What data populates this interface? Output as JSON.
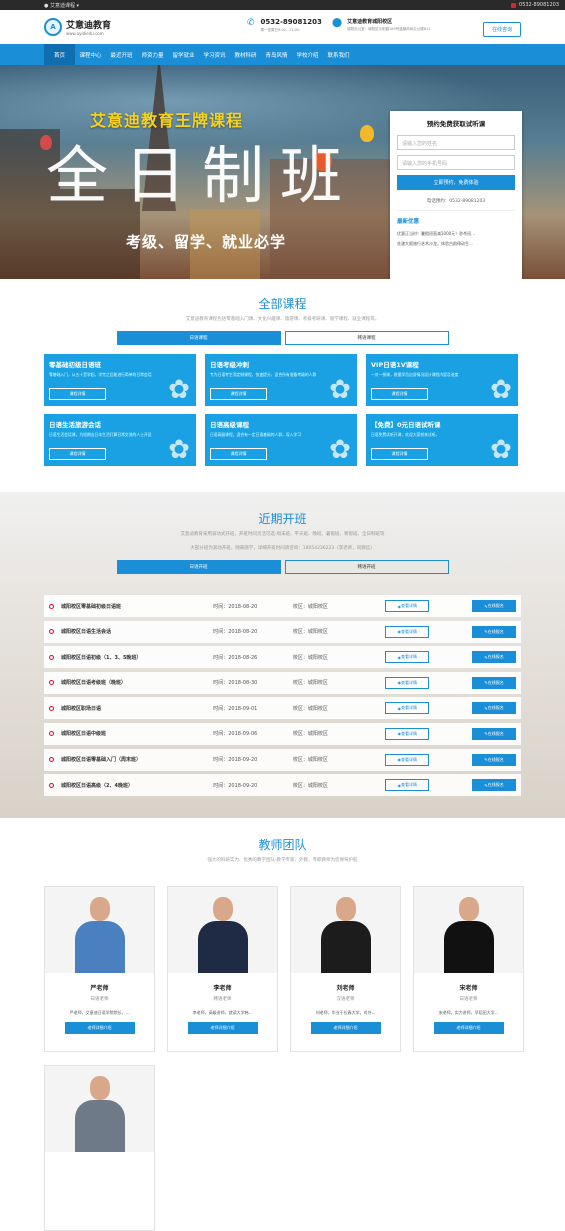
{
  "topbar": {
    "left": "艾意迪课程",
    "phone": "0532-89081203"
  },
  "header": {
    "brand": "艾意迪教育",
    "brand_url": "www.ayidiedu.com",
    "phone": "0532-89081203",
    "hours": "周一至周日9:00 - 21:00",
    "campus": "艾意迪教育城阳校区",
    "address": "城阳办公室：城阳区沙阳路189号蓝鼎风尚办公楼611",
    "consult": "在线咨询"
  },
  "nav": [
    "首页",
    "课程中心",
    "最近开班",
    "师资力量",
    "留学就业",
    "学习资讯",
    "教材科研",
    "青岛风情",
    "学校介绍",
    "联系我们"
  ],
  "hero": {
    "headline": "艾意迪教育王牌课程",
    "big": "全日制班",
    "sub": "考级、留学、就业必学",
    "form": {
      "title": "预约免费获取试听课",
      "name_ph": "请输入您的姓名",
      "phone_ph": "请输入您的手机号码",
      "submit": "立即预约，免费体验",
      "hotline": "电话预约：0532-89081203",
      "news_title": "最新优惠",
      "news": [
        "优惠正当时！暑假班直减1000元！秒杀班...",
        "花漾大阪旅行艺术沙龙，体验古韵律动生..."
      ]
    }
  },
  "courses": {
    "title": "全部课程",
    "subtitle": "艾意迪教育课程包括零基础入门课、文化兴趣课、旅游课、考级考研课、留学课程、就业课程等。",
    "tabs": [
      "日语课程",
      "韩语课程"
    ],
    "cards": [
      {
        "t": "零基础初级日语班",
        "d": "零基础入门，从五十音学起，学完之后能进行简单的日常会话",
        "b": "课程详情"
      },
      {
        "t": "日语考级冲刺",
        "d": "专为日语考生而定制课程，快速提分，适合所有准备考级的人群",
        "b": "课程详情"
      },
      {
        "t": "VIP日语1V课程",
        "d": "一对一授课，根据学员自身情况设计课程内容及进度",
        "b": "课程详情"
      },
      {
        "t": "日语生活旅游会话",
        "d": "日语生活会话课，为短期去日本生活打算日常交流的人士开设",
        "b": "课程详情"
      },
      {
        "t": "日语高级课程",
        "d": "日语高级课程，适合有一定日语基础的人群，深入学习",
        "b": "课程详情"
      },
      {
        "t": "【免费】0元日语试听课",
        "d": "日语免费试听开课，欢迎大家前来试听。",
        "b": "课程详情"
      }
    ]
  },
  "classes": {
    "title": "近期开班",
    "subtitle": "艾意迪教育采用滚动式开班，开班时间灵活可选-周末班、平天班、晚班、暑假班、寒假班、全日制班等",
    "note": "大部分班为滚动开班，随来随学，详细开班时间请咨询：18054236223（李老师，同微信）",
    "tabs": [
      "日语开班",
      "韩语开班"
    ],
    "view": "查看详情",
    "apply": "在线报名",
    "rows": [
      {
        "n": "城阳校区零基础初级日语班",
        "tm": "时间：2018-08-20",
        "s": "校区：城阳校区"
      },
      {
        "n": "城阳校区日语生活会话",
        "tm": "时间：2018-08-20",
        "s": "校区：城阳校区"
      },
      {
        "n": "城阳校区日语初级（1、3、5晚班）",
        "tm": "时间：2018-08-26",
        "s": "校区：城阳校区"
      },
      {
        "n": "城阳校区日语考级班（晚班）",
        "tm": "时间：2018-08-30",
        "s": "校区：城阳校区"
      },
      {
        "n": "城阳校区职场日语",
        "tm": "时间：2018-09-01",
        "s": "校区：城阳校区"
      },
      {
        "n": "城阳校区日语中级班",
        "tm": "时间：2018-09-06",
        "s": "校区：城阳校区"
      },
      {
        "n": "城阳校区日语零基础入门（周末班）",
        "tm": "时间：2018-09-20",
        "s": "校区：城阳校区"
      },
      {
        "n": "城阳校区日语高级（2、4晚班）",
        "tm": "时间：2018-09-20",
        "s": "校区：城阳校区"
      }
    ]
  },
  "teachers": {
    "title": "教师团队",
    "subtitle": "强大的科研实力、优秀的教学团队-教学专家、外教、专职教师为您保驾护航",
    "btn": "老师详细介绍",
    "list": [
      {
        "nm": "严老师",
        "rl": "日语老师",
        "ds": "严老师，艾意迪日语学院院长，..."
      },
      {
        "nm": "李老师",
        "rl": "韩语老师",
        "ds": "李老师，高级讲师，就读大学韩..."
      },
      {
        "nm": "刘老师",
        "rl": "汉语老师",
        "ds": "刘老师，毕业于长春大学，对外..."
      },
      {
        "nm": "宋老师",
        "rl": "日语老师",
        "ds": "宋老师，实力讲师，早稻田大学..."
      },
      {
        "nm": "",
        "rl": "",
        "ds": ""
      }
    ]
  }
}
